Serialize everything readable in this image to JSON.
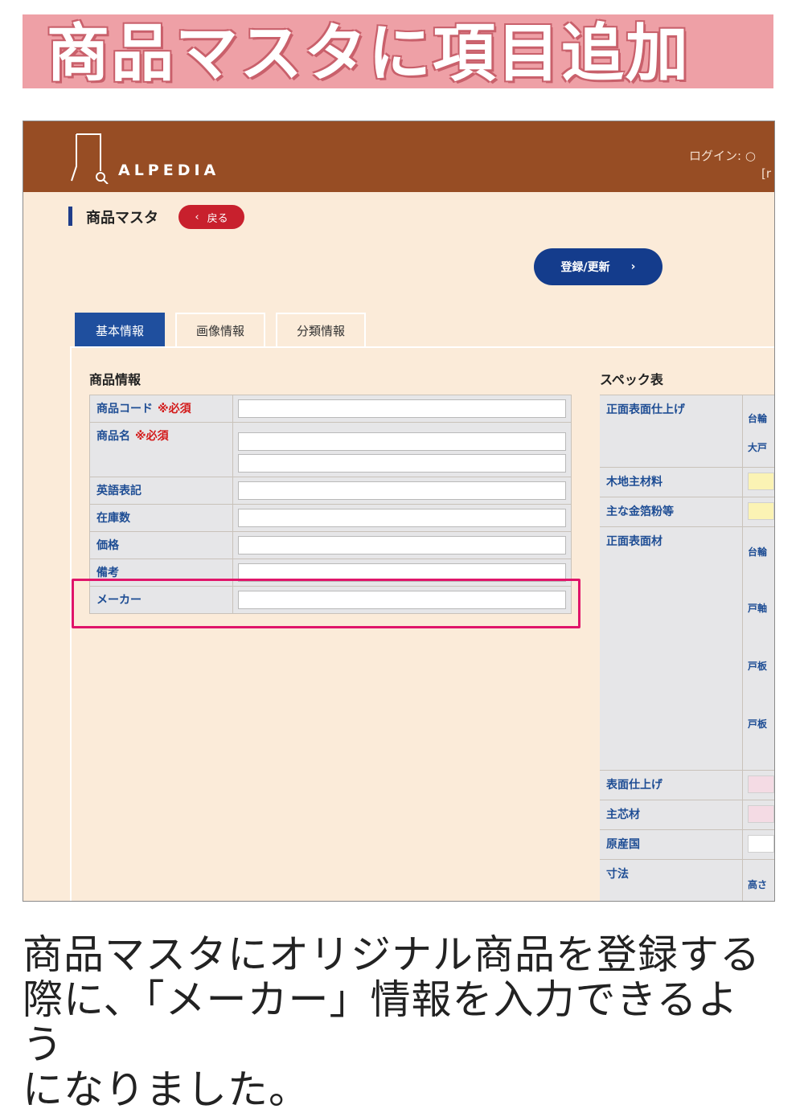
{
  "banner": {
    "title": "商品マスタに項目追加",
    "color": "#eea0a6"
  },
  "app": {
    "logo_text": "ALPEDIA",
    "login_label": "ログイン: ○",
    "login_user": "[r",
    "header_color": "#974d24",
    "page_title": "商品マスタ",
    "back_button": "戻る",
    "register_button": "登録/更新"
  },
  "tabs": [
    {
      "label": "基本情報",
      "active": true
    },
    {
      "label": "画像情報",
      "active": false
    },
    {
      "label": "分類情報",
      "active": false
    }
  ],
  "product_info": {
    "title": "商品情報",
    "required_mark": "※必須",
    "rows": [
      {
        "label": "商品コード",
        "required": true
      },
      {
        "label": "商品名",
        "required": true
      },
      {
        "label": "英語表記",
        "required": false
      },
      {
        "label": "在庫数",
        "required": false
      },
      {
        "label": "価格",
        "required": false
      },
      {
        "label": "備考",
        "required": false
      },
      {
        "label": "メーカー",
        "required": false
      }
    ]
  },
  "spec": {
    "title": "スペック表",
    "rows": [
      {
        "label": "正面表面仕上げ",
        "subs": [
          "台輪",
          "大戸"
        ]
      },
      {
        "label": "木地主材料",
        "swatch": "#fbf3b4"
      },
      {
        "label": "主な金箔粉等",
        "swatch": "#fbf3b4"
      },
      {
        "label": "正面表面材",
        "subs": [
          "台輪",
          "戸軸",
          "戸板",
          "戸板"
        ]
      },
      {
        "label": "表面仕上げ",
        "swatch": "#f4dbe4"
      },
      {
        "label": "主芯材",
        "swatch": "#f4dbe4"
      },
      {
        "label": "原産国",
        "swatch": "#ffffff"
      },
      {
        "label": "寸法",
        "subs": [
          "高さ"
        ]
      }
    ]
  },
  "caption": {
    "line1": "商品マスタにオリジナル商品を登録する",
    "line2": "際に、「メーカー」情報を入力できるよう",
    "line3": "になりました。"
  }
}
